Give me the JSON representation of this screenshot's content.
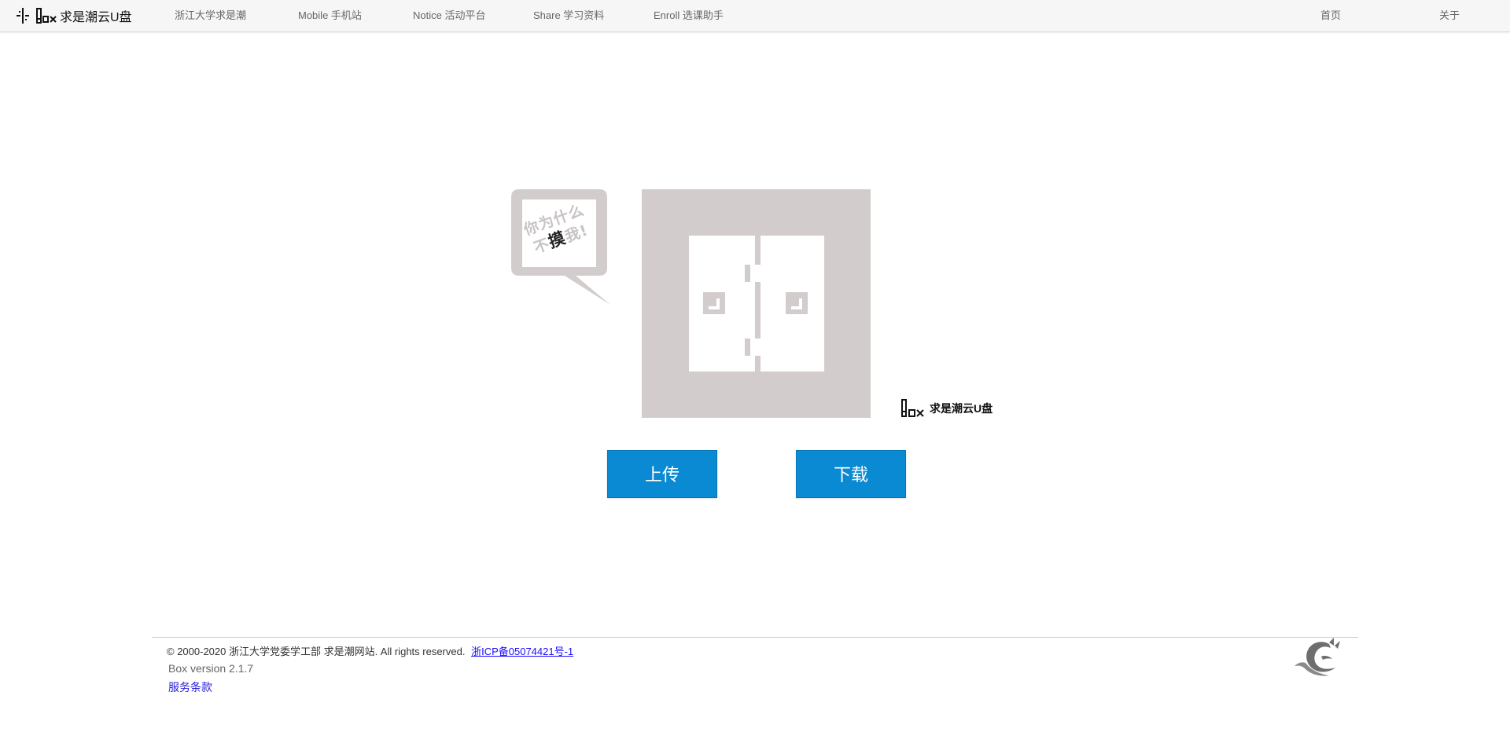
{
  "header": {
    "brand_text": "求是潮云U盘",
    "nav": [
      {
        "label": "浙江大学求是潮"
      },
      {
        "label": "Mobile 手机站"
      },
      {
        "label": "Notice 活动平台"
      },
      {
        "label": "Share 学习资料"
      },
      {
        "label": "Enroll 选课助手"
      },
      {
        "label": "首页"
      },
      {
        "label": "关于"
      }
    ]
  },
  "hero": {
    "bubble": {
      "line1": "你为什么",
      "line2_prefix": "不",
      "line2_emph": "摸",
      "line2_suffix": "我!"
    },
    "brand_mark_text": "求是潮云U盘",
    "upload_label": "上传",
    "download_label": "下载"
  },
  "footer": {
    "copyright": "© 2000-2020 浙江大学党委学工部 求是潮网站. All rights reserved.",
    "icp": "浙ICP备05074421号-1",
    "version": "Box version 2.1.7",
    "terms": "服务条款"
  },
  "colors": {
    "accent": "#0a8ad3",
    "logo_gray": "#d3cccc",
    "link": "#1a0dff"
  }
}
